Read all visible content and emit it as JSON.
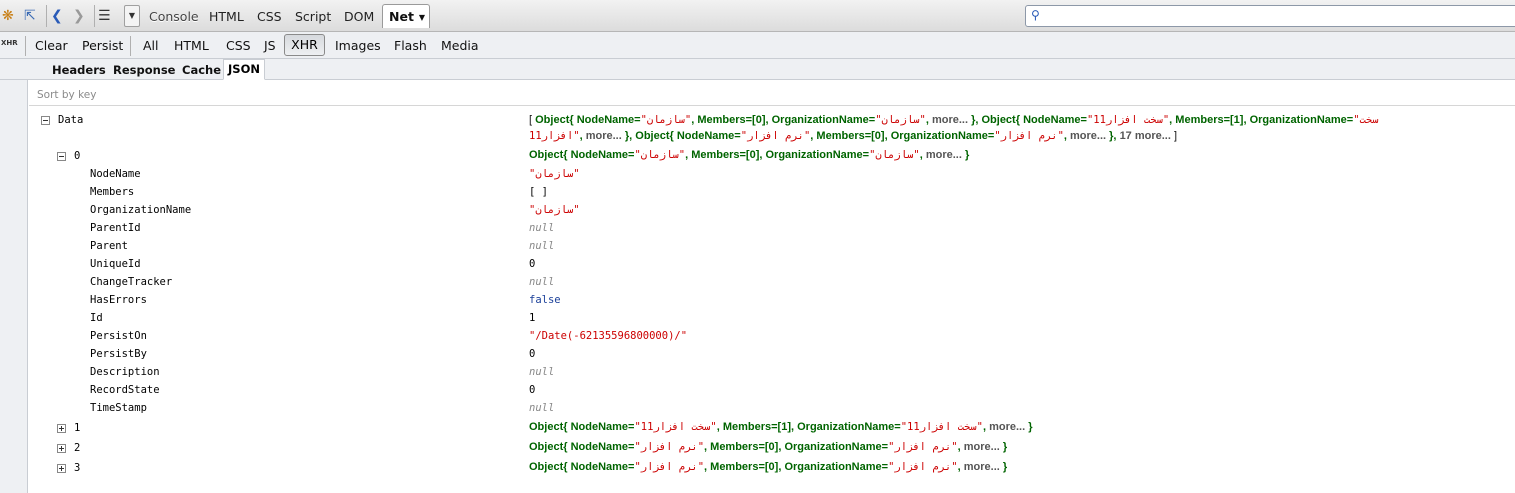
{
  "toolbar": {
    "tabs": [
      "Console",
      "HTML",
      "CSS",
      "Script",
      "DOM"
    ],
    "net_label": "Net",
    "search_value": ""
  },
  "toolbar2": {
    "xhr_icon_label": "XHR",
    "clear": "Clear",
    "persist": "Persist",
    "filters": [
      "All",
      "HTML",
      "CSS",
      "JS",
      "XHR",
      "Images",
      "Flash",
      "Media"
    ],
    "active_filter": "XHR"
  },
  "subtabs": [
    "Headers",
    "Response",
    "Cache",
    "JSON"
  ],
  "active_subtab": "JSON",
  "sort_label": "Sort by key",
  "tree": {
    "root_key": "Data",
    "root_summary_line1": {
      "open": "[",
      "obj0": {
        "label": "Object",
        "kv1": "NodeName=",
        "s1": "\"سازمان\"",
        "kv2": "Members=[0],",
        "kv3": "OrganizationName=",
        "s3": "\"سازمان\"",
        "more": "more...",
        "close": "},"
      },
      "obj1": {
        "label": "Object",
        "kv1": "NodeName=",
        "s1": "\"سخت افزار11\"",
        "kv2": "Members=[1],",
        "kv3": "OrganizationName=",
        "s3": "\"سخت"
      }
    },
    "root_summary_line2": {
      "s3_cont": "افزار11\"",
      "more1": "more...",
      "close1": "},",
      "obj2": {
        "label": "Object",
        "kv1": "NodeName=",
        "s1": "\"نرم افزار\"",
        "kv2": "Members=[0],",
        "kv3": "OrganizationName=",
        "s3": "\"نرم افزار\"",
        "more": "more...",
        "close": "},"
      },
      "more_count": "17 more...",
      "close": "]"
    },
    "item0": {
      "key": "0",
      "summary": {
        "label": "Object",
        "kv1": "NodeName=",
        "s1": "\"سازمان\"",
        "kv2": "Members=[0],",
        "kv3": "OrganizationName=",
        "s3": "\"سازمان\"",
        "more": "more...",
        "close": "}"
      },
      "fields": [
        {
          "k": "NodeName",
          "v": "\"سازمان\"",
          "t": "str"
        },
        {
          "k": "Members",
          "v": "[ ]",
          "t": "plain"
        },
        {
          "k": "OrganizationName",
          "v": "\"سازمان\"",
          "t": "str"
        },
        {
          "k": "ParentId",
          "v": "null",
          "t": "null"
        },
        {
          "k": "Parent",
          "v": "null",
          "t": "null"
        },
        {
          "k": "UniqueId",
          "v": "0",
          "t": "plain"
        },
        {
          "k": "ChangeTracker",
          "v": "null",
          "t": "null"
        },
        {
          "k": "HasErrors",
          "v": "false",
          "t": "bool"
        },
        {
          "k": "Id",
          "v": "1",
          "t": "plain"
        },
        {
          "k": "PersistOn",
          "v": "\"/Date(-62135596800000)/\"",
          "t": "str"
        },
        {
          "k": "PersistBy",
          "v": "0",
          "t": "plain"
        },
        {
          "k": "Description",
          "v": "null",
          "t": "null"
        },
        {
          "k": "RecordState",
          "v": "0",
          "t": "plain"
        },
        {
          "k": "TimeStamp",
          "v": "null",
          "t": "null"
        }
      ]
    },
    "collapsed_items": [
      {
        "key": "1",
        "label": "Object",
        "kv1": "NodeName=",
        "s1": "\"سخت افزار11\"",
        "kv2": "Members=[1],",
        "kv3": "OrganizationName=",
        "s3": "\"سخت افزار11\"",
        "more": "more...",
        "close": "}"
      },
      {
        "key": "2",
        "label": "Object",
        "kv1": "NodeName=",
        "s1": "\"نرم افزار\"",
        "kv2": "Members=[0],",
        "kv3": "OrganizationName=",
        "s3": "\"نرم افزار\"",
        "more": "more...",
        "close": "}"
      },
      {
        "key": "3",
        "label": "Object",
        "kv1": "NodeName=",
        "s1": "\"نرم افزار\"",
        "kv2": "Members=[0],",
        "kv3": "OrganizationName=",
        "s3": "\"نرم افزار\"",
        "more": "more...",
        "close": "}"
      }
    ]
  }
}
